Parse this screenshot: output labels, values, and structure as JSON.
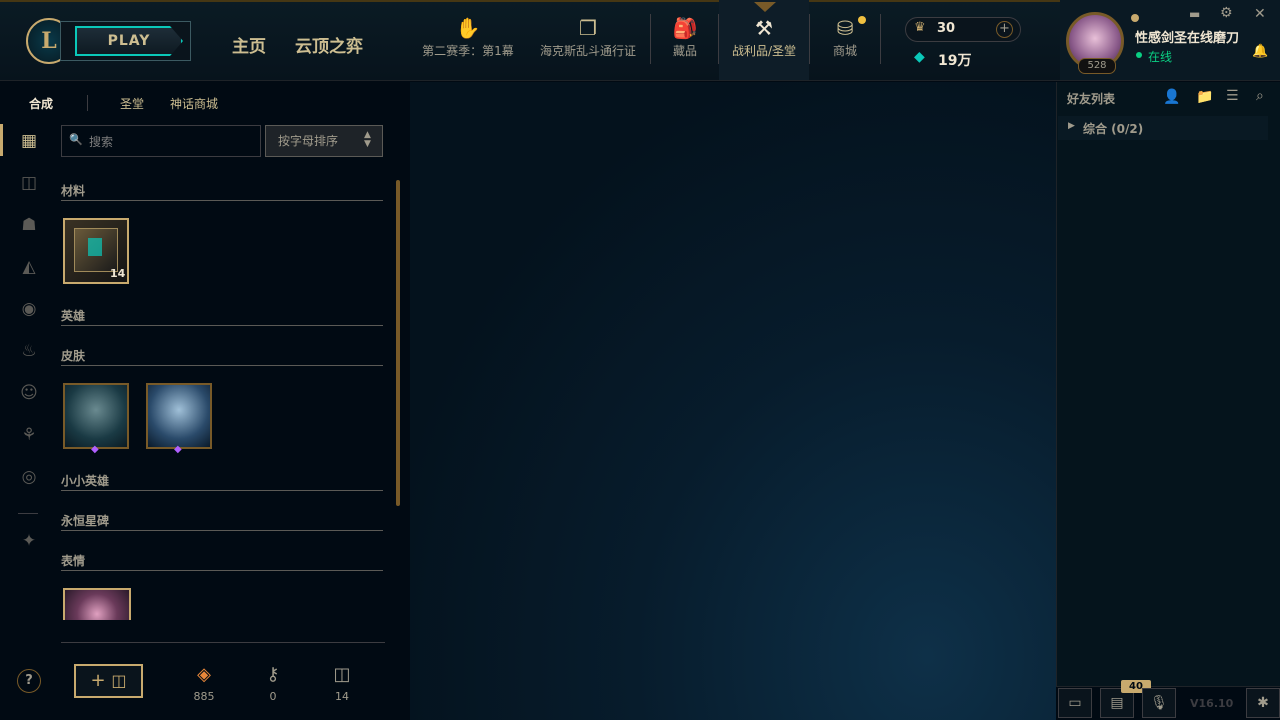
{
  "topbar": {
    "play_label": "PLAY",
    "home_label": "主页",
    "tft_label": "云顶之弈",
    "nav": [
      {
        "icon": "season-icon",
        "label": "第二赛季：第1幕"
      },
      {
        "icon": "pass-icon",
        "label": "海克斯乱斗通行证"
      },
      {
        "icon": "collection-icon",
        "label": "藏品"
      },
      {
        "icon": "loot-icon",
        "label": "战利品/圣堂"
      },
      {
        "icon": "store-icon",
        "label": "商城"
      }
    ],
    "rp": "30",
    "be": "19万",
    "profile": {
      "name": "性感剑圣在线磨刀",
      "status": "在线",
      "level": "528"
    },
    "window": {
      "minimize": "▬",
      "settings": "⚙",
      "close": "✕"
    }
  },
  "loot": {
    "tabs": [
      "合成",
      "圣堂",
      "神话商城"
    ],
    "search_placeholder": "搜索",
    "sort_label": "按字母排序",
    "sections": {
      "materials": "材料",
      "champions": "英雄",
      "skins": "皮肤",
      "companions": "小小英雄",
      "eternals": "永恒星碑",
      "emotes": "表情"
    },
    "chest_count": "14",
    "counters": [
      {
        "icon": "orange-essence-icon",
        "value": "885"
      },
      {
        "icon": "key-icon",
        "value": "0"
      },
      {
        "icon": "chest-icon",
        "value": "14"
      }
    ],
    "craft_label": "+"
  },
  "friends": {
    "title": "好友列表",
    "group": "综合 (0/2)"
  },
  "bottom": {
    "badge": "40",
    "version": "V16.10"
  },
  "help": "?"
}
